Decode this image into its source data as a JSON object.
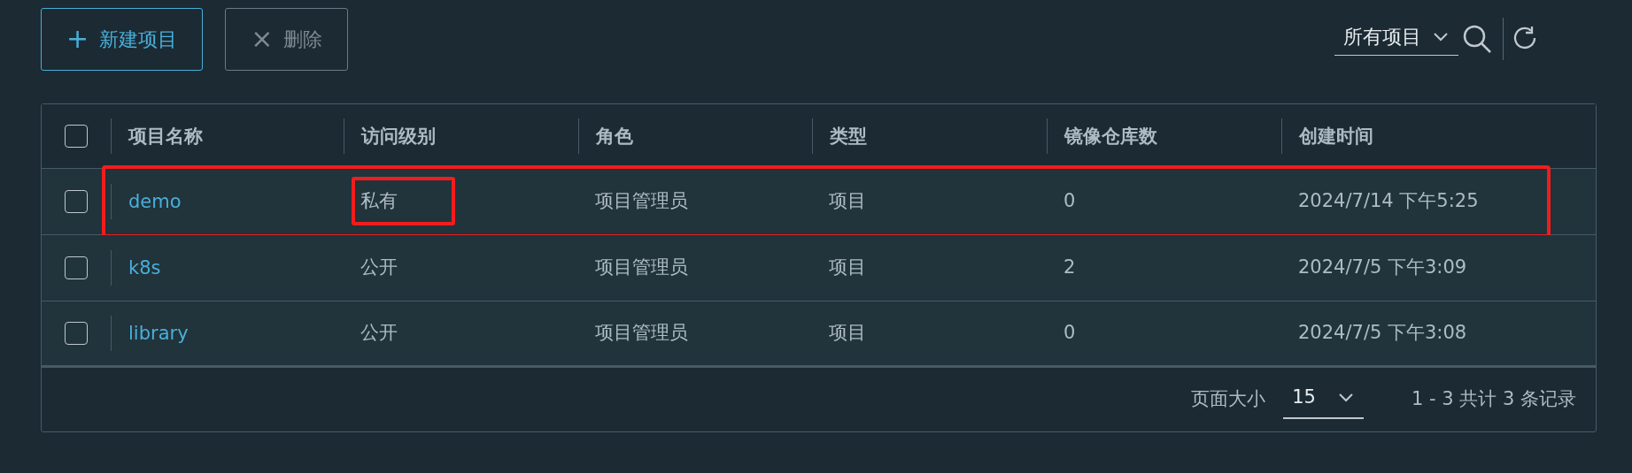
{
  "toolbar": {
    "new_button": {
      "icon": "+",
      "label": "新建项目",
      "disabled": false
    },
    "delete_button": {
      "icon": "×",
      "label": "删除",
      "disabled": true
    },
    "filter": {
      "value": "所有项目"
    }
  },
  "table": {
    "select_all": {
      "checked": false
    },
    "columns": [
      "项目名称",
      "访问级别",
      "角色",
      "类型",
      "镜像仓库数",
      "创建时间"
    ],
    "rows": [
      {
        "checked": false,
        "highlighted": true,
        "name": "demo",
        "access": "私有",
        "access_highlighted": true,
        "role": "项目管理员",
        "type": "项目",
        "repo_count": "0",
        "created": "2024/7/14 下午5:25"
      },
      {
        "checked": false,
        "highlighted": false,
        "name": "k8s",
        "access": "公开",
        "access_highlighted": false,
        "role": "项目管理员",
        "type": "项目",
        "repo_count": "2",
        "created": "2024/7/5 下午3:09"
      },
      {
        "checked": false,
        "highlighted": false,
        "name": "library",
        "access": "公开",
        "access_highlighted": false,
        "role": "项目管理员",
        "type": "项目",
        "repo_count": "0",
        "created": "2024/7/5 下午3:08"
      }
    ]
  },
  "footer": {
    "page_size_label": "页面大小",
    "page_size": "15",
    "summary": "1 - 3 共计 3 条记录"
  }
}
